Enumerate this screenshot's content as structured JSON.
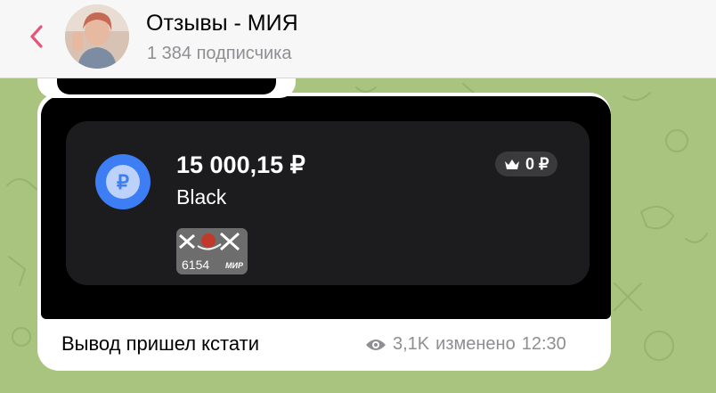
{
  "header": {
    "back_icon": "chevron-left-icon",
    "title": "Отзывы - МИЯ",
    "subtitle": "1 384 подписчика",
    "accent_color": "#e3577d"
  },
  "message": {
    "card": {
      "amount": "15 000,15 ₽",
      "name": "Black",
      "currency_icon": "ruble-coin-icon",
      "badge_text": "0 ₽",
      "badge_icon": "crown-icon",
      "mini_card_number": "6154",
      "mini_card_brand": "МИР"
    },
    "caption": "Вывод пришел кстати",
    "views_icon": "eye-icon",
    "views": "3,1K",
    "edited_label": "изменено",
    "time": "12:30"
  },
  "colors": {
    "chat_background": "#a8c47e",
    "card_background": "#1c1c1e",
    "coin_blue": "#3d7ef5"
  }
}
